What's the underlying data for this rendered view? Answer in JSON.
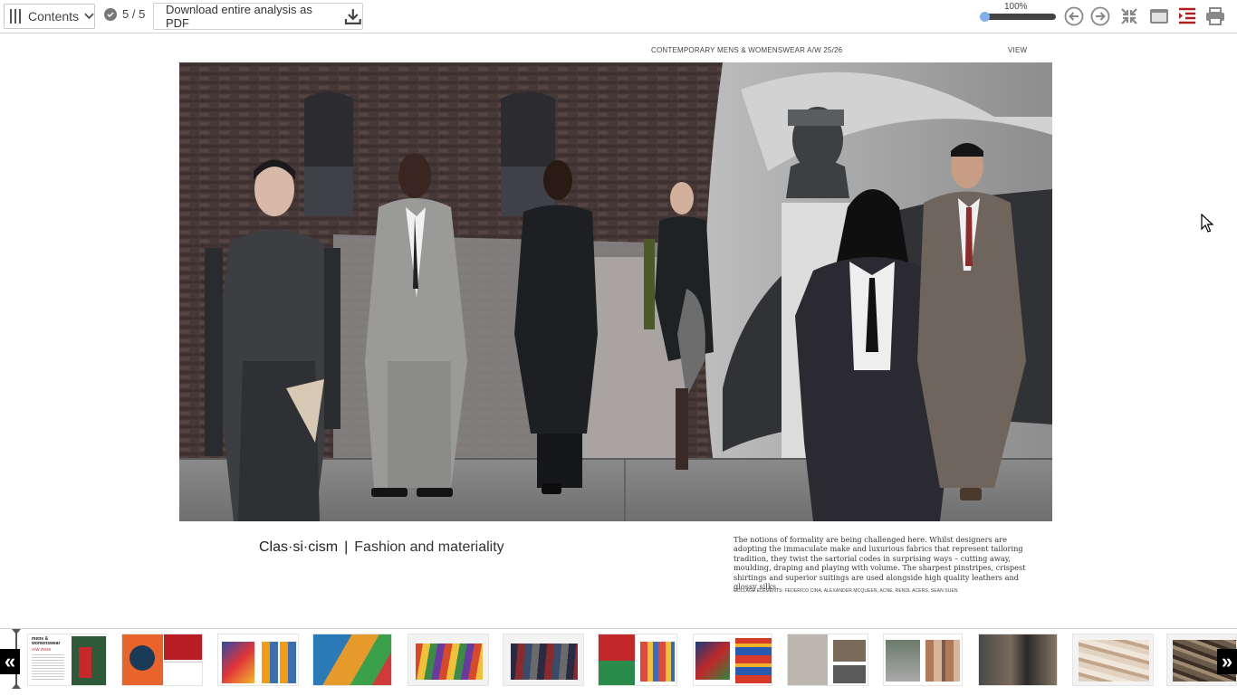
{
  "toolbar": {
    "contents_label": "Contents",
    "page_indicator": "5 / 5",
    "download_label": "Download entire analysis as PDF",
    "zoom_label": "100%",
    "zoom_level": 1.0,
    "icons": [
      "contents-bars-icon",
      "chevron-down-icon",
      "check-circle-icon",
      "download-icon",
      "arrow-left-circle-icon",
      "arrow-right-circle-icon",
      "collapse-icon",
      "single-page-icon",
      "outline-icon",
      "print-icon"
    ]
  },
  "page": {
    "header": "CONTEMPORARY MENS & WOMENSWEAR A/W 25/26",
    "view_label": "VIEW",
    "title": "Clas·si·cism",
    "separator": "|",
    "subtitle": "Fashion and materiality",
    "body": "The notions of formality are being challenged here. Whilst designers are adopting the immaculate make and luxurious fabrics that represent tailoring tradition, they twist the sartorial codes in surprising ways – cutting away, moulding, draping and playing with volume. The sharpest pinstripes, crispest shirtings and superior suitings are used alongside high quality leathers and glossy silks.",
    "credits": "COLLAGE ELEMENTS: FEDERICO CINA, ALEXANDER MCQUEEN, ACNE, RENDL ACERS, SEAN SUEN"
  },
  "thumbnails": {
    "prev_label": "«",
    "next_label": "»",
    "cover_title": "mens & womenswear",
    "cover_subtitle": "A/W 25/26",
    "count": 13
  },
  "colors": {
    "accent_red": "#b01e1e",
    "zoom_knob": "#7fb0e8",
    "icon_gray": "#888888"
  }
}
